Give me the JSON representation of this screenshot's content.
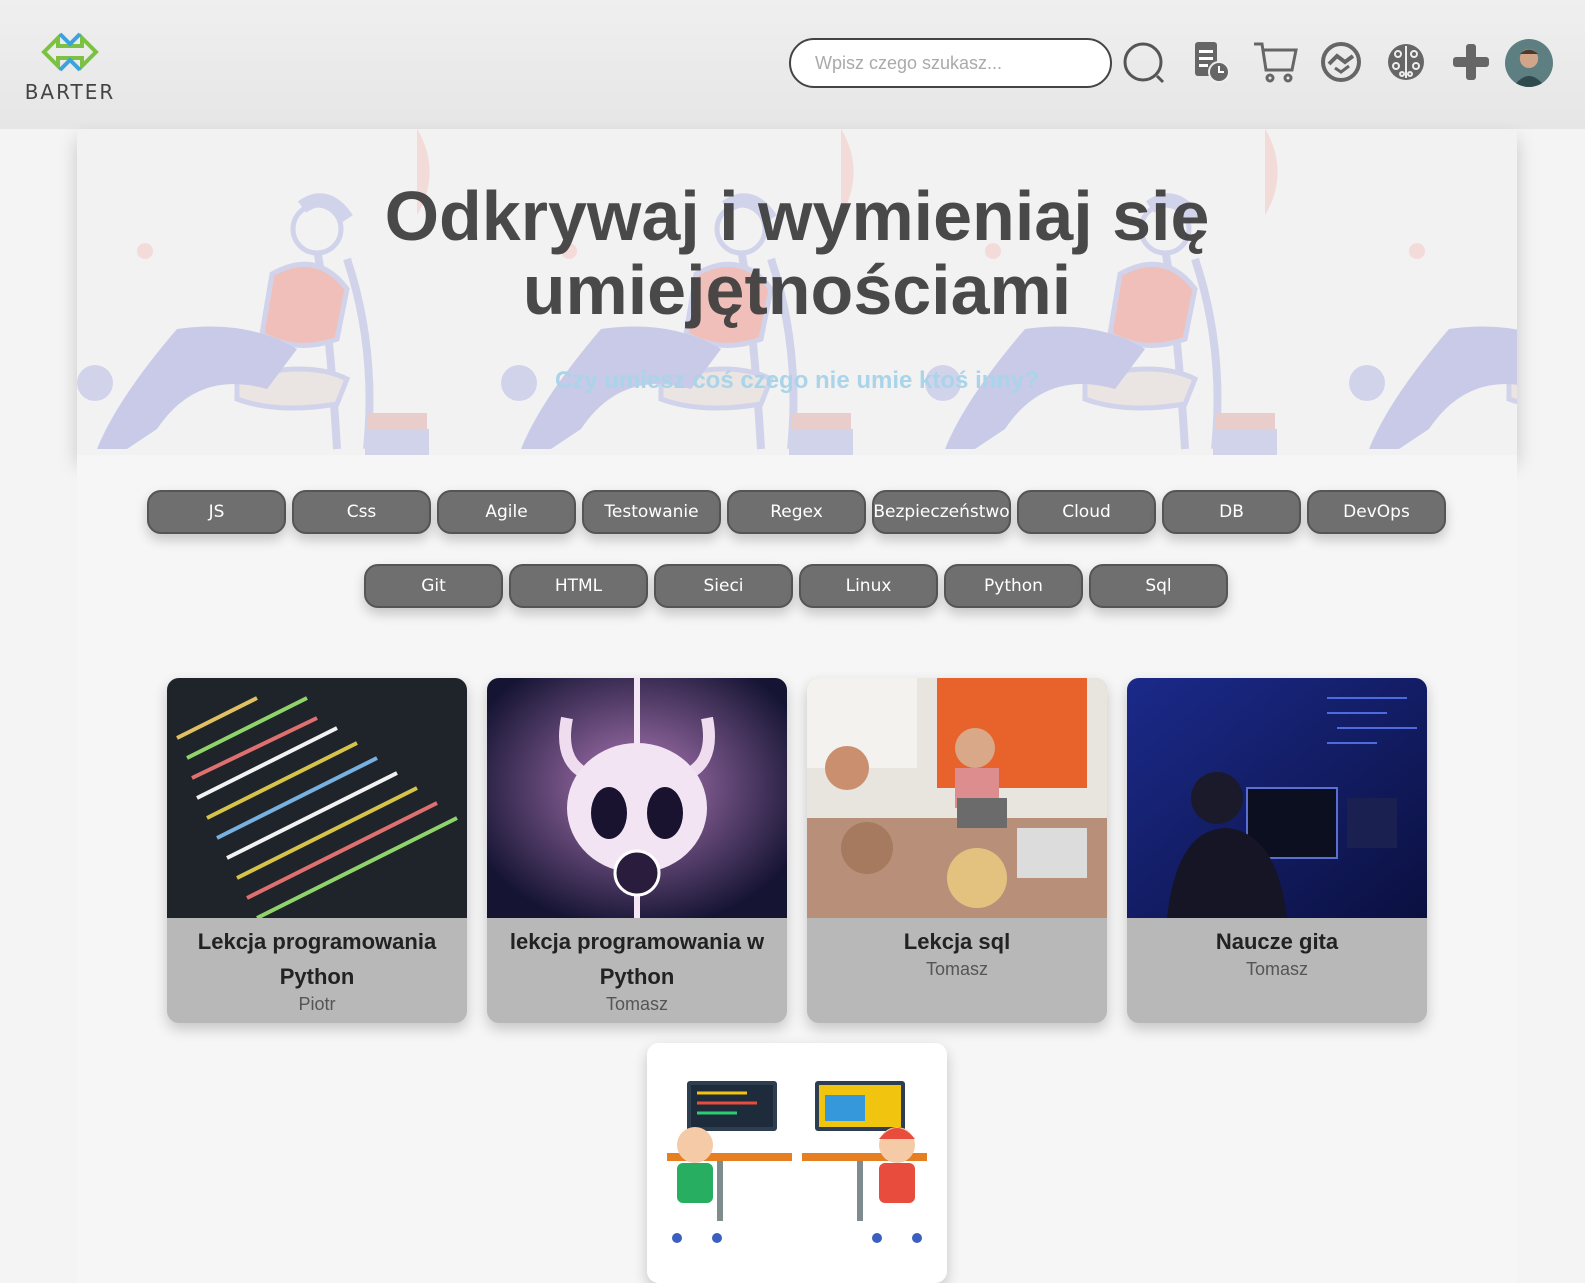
{
  "header": {
    "logo_text": "BARTER",
    "search_placeholder": "Wpisz czego szukasz...",
    "icons": [
      "search-icon",
      "document-clock-icon",
      "cart-icon",
      "handshake-icon",
      "brain-icon",
      "plus-icon",
      "avatar"
    ]
  },
  "hero": {
    "title_line1": "Odkrywaj i wymieniaj się",
    "title_line2": "umiejętnościami",
    "subtitle": "Czy umiesz coś czego nie umie ktoś inny?"
  },
  "tags_row1": [
    "JS",
    "Css",
    "Agile",
    "Testowanie",
    "Regex",
    "Bezpieczeństwo",
    "Cloud",
    "DB",
    "DevOps"
  ],
  "tags_row2": [
    "Git",
    "HTML",
    "Sieci",
    "Linux",
    "Python",
    "Sql"
  ],
  "cards": [
    {
      "title": "Lekcja programowania Python",
      "author": "Piotr"
    },
    {
      "title": "lekcja programowania w Python",
      "author": "Tomasz"
    },
    {
      "title": "Lekcja sql",
      "author": "Tomasz"
    },
    {
      "title": "Naucze gita",
      "author": "Tomasz"
    }
  ],
  "colors": {
    "accent_green": "#7cc242",
    "accent_blue": "#3ba3d9",
    "tag_bg": "#6f6f6f",
    "card_bg": "#b8b8b8"
  }
}
